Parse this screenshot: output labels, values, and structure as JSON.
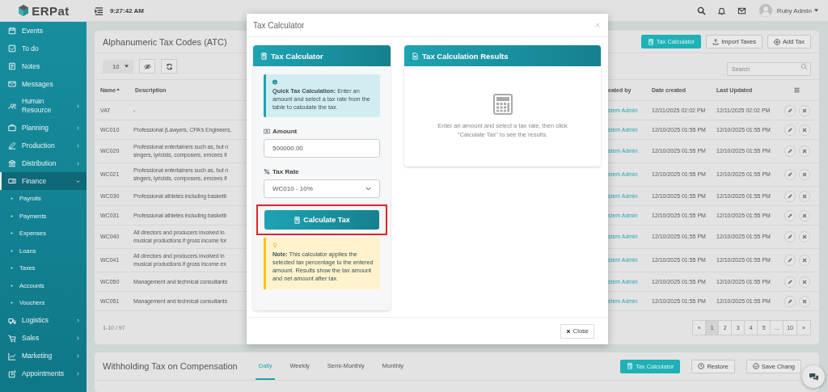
{
  "topbar": {
    "logo": "ERPat",
    "time": "9:27:42 AM",
    "user": "Ruby Admin"
  },
  "sidebar": {
    "items": [
      {
        "label": "Events",
        "selected": false
      },
      {
        "label": "To do",
        "selected": false
      },
      {
        "label": "Notes",
        "selected": false
      },
      {
        "label": "Messages",
        "selected": false
      },
      {
        "label": "Human Resource",
        "selected": false,
        "expanded": false
      },
      {
        "label": "Planning",
        "selected": false,
        "expanded": false
      },
      {
        "label": "Production",
        "selected": false,
        "expanded": false
      },
      {
        "label": "Distribution",
        "selected": false,
        "expanded": false
      },
      {
        "label": "Finance",
        "selected": true,
        "expanded": true,
        "children": [
          {
            "label": "Payrolls",
            "selected": false
          },
          {
            "label": "Payments",
            "selected": false
          },
          {
            "label": "Expenses",
            "selected": false
          },
          {
            "label": "Loans",
            "selected": false
          },
          {
            "label": "Taxes",
            "selected": false
          },
          {
            "label": "Accounts",
            "selected": false
          },
          {
            "label": "Vouchers",
            "selected": false
          }
        ]
      },
      {
        "label": "Logistics",
        "selected": false,
        "expanded": false
      },
      {
        "label": "Sales",
        "selected": false,
        "expanded": false
      },
      {
        "label": "Marketing",
        "selected": false,
        "expanded": false
      },
      {
        "label": "Appointments",
        "selected": false,
        "expanded": false
      }
    ]
  },
  "tax_codes": {
    "title": "Alphanumeric Tax Codes (ATC)",
    "buttons": [
      {
        "label": "Tax Calculator",
        "kind": "primary"
      },
      {
        "label": "Import Taxes",
        "kind": "default"
      },
      {
        "label": "Add Tax",
        "kind": "default"
      }
    ],
    "page_size": "10",
    "search": {
      "placeholder": "Search"
    },
    "columns": [
      {
        "label": "Name",
        "sorted": true
      },
      {
        "label": "Description",
        "sorted": false
      },
      {
        "label": "eated by",
        "sorted": false
      },
      {
        "label": "Date created",
        "sorted": false
      },
      {
        "label": "Last Updated",
        "sorted": false
      }
    ],
    "rows": [
      {
        "name": "VAT",
        "description": [
          "-"
        ],
        "created_by": "stem Admin",
        "date_created": "12/11/2025 02:02 PM",
        "last_updated": "12/11/2025 02:02 PM"
      },
      {
        "name": "WC010",
        "description": [
          "Professional (Lawyers, CPA's Engineers,"
        ],
        "created_by": "stem Admin",
        "date_created": "12/10/2025 01:55 PM",
        "last_updated": "12/10/2025 01:55 PM"
      },
      {
        "name": "WC020",
        "description": [
          "Professional entertainers such as, but n",
          "singers, lyricists, composers, emcees if"
        ],
        "created_by": "stem Admin",
        "date_created": "12/10/2025 01:55 PM",
        "last_updated": "12/10/2025 01:55 PM"
      },
      {
        "name": "WC021",
        "description": [
          "Professional entertainers such as, but n",
          "singers, lyricists, composers, emcees if"
        ],
        "created_by": "stem Admin",
        "date_created": "12/10/2025 01:55 PM",
        "last_updated": "12/10/2025 01:55 PM"
      },
      {
        "name": "WC030",
        "description": [
          "Professional athletes including basketb"
        ],
        "created_by": "stem Admin",
        "date_created": "12/10/2025 01:55 PM",
        "last_updated": "12/10/2025 01:55 PM"
      },
      {
        "name": "WC031",
        "description": [
          "Professional athletes including basketb"
        ],
        "created_by": "stem Admin",
        "date_created": "12/10/2025 01:55 PM",
        "last_updated": "12/10/2025 01:55 PM"
      },
      {
        "name": "WC040",
        "description": [
          "All directors and producers involved in",
          "musical productions if gross income for"
        ],
        "created_by": "stem Admin",
        "date_created": "12/10/2025 01:55 PM",
        "last_updated": "12/10/2025 01:55 PM"
      },
      {
        "name": "WC041",
        "description": [
          "All directors and producers involved in",
          "musical productions if gross income ex"
        ],
        "created_by": "stem Admin",
        "date_created": "12/10/2025 01:55 PM",
        "last_updated": "12/10/2025 01:55 PM"
      },
      {
        "name": "WC050",
        "description": [
          "Management and technical consultants"
        ],
        "created_by": "stem Admin",
        "date_created": "12/10/2025 01:55 PM",
        "last_updated": "12/10/2025 01:55 PM"
      },
      {
        "name": "WC051",
        "description": [
          "Management and technical consultants"
        ],
        "created_by": "stem Admin",
        "date_created": "12/10/2025 01:55 PM",
        "last_updated": "12/10/2025 01:55 PM"
      }
    ],
    "summary": "1-10 / 97",
    "pagination": [
      {
        "label": "«",
        "selected": false
      },
      {
        "label": "1",
        "selected": true
      },
      {
        "label": "2",
        "selected": false
      },
      {
        "label": "3",
        "selected": false
      },
      {
        "label": "4",
        "selected": false
      },
      {
        "label": "5",
        "selected": false
      },
      {
        "label": "...",
        "selected": false
      },
      {
        "label": "10",
        "selected": false
      },
      {
        "label": "»",
        "selected": false
      }
    ]
  },
  "withholding": {
    "title": "Withholding Tax on Compensation",
    "tabs": [
      {
        "label": "Daily",
        "selected": true
      },
      {
        "label": "Weekly",
        "selected": false
      },
      {
        "label": "Semi-Monthly",
        "selected": false
      },
      {
        "label": "Monthly",
        "selected": false
      }
    ],
    "buttons": [
      {
        "label": "Tax Calculator",
        "kind": "primary"
      },
      {
        "label": "Restore",
        "kind": "default"
      },
      {
        "label": "Save Chang",
        "kind": "default"
      }
    ]
  },
  "modal": {
    "title": "Tax Calculator",
    "calculator": {
      "title": "Tax Calculator",
      "info": "**Quick Tax Calculation:** Enter an amount and select a tax rate from the table to calculate the tax.",
      "amount_label": "Amount",
      "amount": "500000.00",
      "rate_label": "Tax Rate",
      "rate": "WC010 - 10%",
      "button": {
        "label": "Calculate Tax",
        "highlighted": true
      },
      "note": "**Note:** This calculator applies the selected tax percentage to the entered amount. Results show the tax amount and net amount after tax."
    },
    "results": {
      "title": "Tax Calculation Results",
      "message": "Enter an amount and select a tax rate, then click \"Calculate Tax\" to see the results."
    },
    "close_label": "Close"
  }
}
